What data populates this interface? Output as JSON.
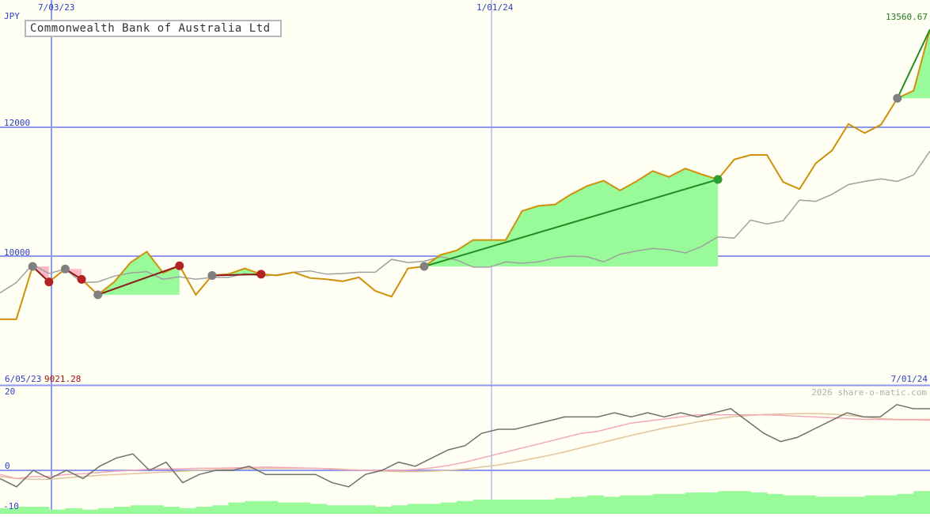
{
  "title": "Commonwealth Bank of Australia Ltd",
  "currency_label": "JPY",
  "watermark": "2026 share-o-matic.com",
  "colors": {
    "background": "#fffff4",
    "grid": "#8e98ee",
    "price": "#d0900a",
    "benchmark": "#a0a0a0",
    "gain_fill": "#98fa98",
    "loss_fill": "#ffb8c8",
    "gain_line": "#228b22",
    "loss_line": "#8b1a1a",
    "gain_dot": "#2e9e2e",
    "loss_dot": "#b22222",
    "pivot_dot": "#808080",
    "momentum": "#707070",
    "ma_fast": "#f4a8b8",
    "ma_slow": "#e2c49c",
    "volume": "#98fa98",
    "label_blue": "#3040c0",
    "label_red": "#a01010",
    "label_green": "#207a20"
  },
  "chart_data": [
    {
      "type": "line",
      "panel": "price",
      "series_unit": "JPY",
      "x_ticks": [
        "7/03/23",
        "1/01/24"
      ],
      "y_ticks": [
        10000,
        12000
      ],
      "ylim": [
        8000,
        13900
      ],
      "range_start_label": "6/05/23",
      "range_end_label": "7/01/24",
      "start_value_label": "9021.28",
      "last_value_label": "13560.67",
      "last_value": 13560.67,
      "series": [
        {
          "role": "price",
          "values": [
            9020,
            9020,
            9840,
            9600,
            9800,
            9640,
            9400,
            9600,
            9900,
            10070,
            9740,
            9850,
            9400,
            9700,
            9720,
            9810,
            9720,
            9700,
            9750,
            9660,
            9640,
            9610,
            9670,
            9460,
            9370,
            9810,
            9840,
            10020,
            10090,
            10250,
            10250,
            10250,
            10700,
            10780,
            10800,
            10960,
            11090,
            11170,
            11020,
            11160,
            11320,
            11230,
            11360,
            11270,
            11190,
            11500,
            11570,
            11570,
            11150,
            11040,
            11440,
            11640,
            12050,
            11910,
            12040,
            12450,
            12570,
            13520
          ]
        },
        {
          "role": "benchmark",
          "values": [
            9430,
            9590,
            9870,
            9730,
            9800,
            9590,
            9600,
            9690,
            9740,
            9760,
            9640,
            9680,
            9640,
            9670,
            9670,
            9730,
            9690,
            9710,
            9750,
            9770,
            9720,
            9730,
            9750,
            9750,
            9950,
            9900,
            9920,
            9990,
            9940,
            9830,
            9830,
            9910,
            9890,
            9910,
            9970,
            10000,
            9990,
            9910,
            10030,
            10080,
            10120,
            10100,
            10050,
            10150,
            10300,
            10280,
            10560,
            10500,
            10550,
            10870,
            10850,
            10960,
            11110,
            11160,
            11200,
            11160,
            11260,
            11630
          ]
        }
      ],
      "trades": [
        {
          "type": "loss",
          "from": 2,
          "to": 3
        },
        {
          "type": "loss",
          "from": 4,
          "to": 5
        },
        {
          "type": "gain",
          "from": 6,
          "to": 11
        },
        {
          "type": "loss",
          "from": 6,
          "to": 11
        },
        {
          "type": "gain",
          "from": 13,
          "to": 16
        },
        {
          "type": "gain",
          "from": 26,
          "to": 44
        },
        {
          "type": "gain",
          "from": 55,
          "to": 57
        }
      ]
    },
    {
      "type": "line",
      "panel": "indicator",
      "y_ticks": [
        20,
        0,
        -10
      ],
      "ylim": [
        -10,
        20
      ],
      "series": [
        {
          "role": "momentum",
          "values": [
            -2,
            -4,
            0,
            -2,
            0,
            -2,
            1,
            3,
            4,
            0,
            2,
            -3,
            -1,
            0,
            0,
            1,
            -1,
            -1,
            -1,
            -1,
            -3,
            -4,
            -1,
            0,
            2,
            1,
            3,
            5,
            6,
            9,
            10,
            10,
            11,
            12,
            13,
            13,
            13,
            14,
            13,
            14,
            13,
            14,
            13,
            14,
            15,
            12,
            9,
            7,
            8,
            10,
            12,
            14,
            13,
            13,
            16,
            15,
            15
          ]
        },
        {
          "role": "ma_fast",
          "values": [
            -1,
            -2,
            -1.5,
            -1.5,
            -1,
            -0.8,
            -0.5,
            -0.2,
            0,
            0.3,
            0.3,
            0.4,
            0.5,
            0.5,
            0.6,
            0.7,
            0.8,
            0.7,
            0.6,
            0.5,
            0.3,
            0.1,
            0,
            0,
            0,
            0.2,
            0.6,
            1.2,
            2,
            3,
            4,
            5,
            6,
            7,
            8,
            9,
            9.5,
            10.5,
            11.5,
            12,
            12.5,
            13,
            13.5,
            13.5,
            13.5,
            13.5,
            13.5,
            13.4,
            13.2,
            13,
            12.8,
            12.6,
            12.4,
            12.4,
            12.3,
            12.3,
            12.2
          ]
        },
        {
          "role": "ma_slow",
          "values": [
            -1.5,
            -2,
            -2.2,
            -2.2,
            -1.8,
            -1.5,
            -1.2,
            -1,
            -0.8,
            -0.6,
            -0.4,
            -0.2,
            0,
            0.2,
            0.3,
            0.4,
            0.5,
            0.5,
            0.5,
            0.5,
            0.4,
            0.2,
            0,
            -0.2,
            -0.3,
            -0.3,
            -0.2,
            0,
            0.3,
            0.8,
            1.3,
            2,
            2.8,
            3.6,
            4.5,
            5.5,
            6.5,
            7.5,
            8.5,
            9.4,
            10.3,
            11,
            11.8,
            12.4,
            13,
            13.3,
            13.6,
            13.7,
            13.8,
            13.8,
            13.7,
            13.4,
            13,
            12.6,
            12.4,
            12.4,
            12.4
          ]
        },
        {
          "role": "volume",
          "values": [
            0.4,
            0.5,
            0.5,
            0.3,
            0.4,
            0.3,
            0.4,
            0.5,
            0.6,
            0.6,
            0.5,
            0.4,
            0.5,
            0.6,
            0.8,
            0.9,
            0.9,
            0.8,
            0.8,
            0.7,
            0.6,
            0.6,
            0.6,
            0.5,
            0.6,
            0.7,
            0.7,
            0.8,
            0.9,
            1.0,
            1.0,
            1.0,
            1.0,
            1.0,
            1.1,
            1.2,
            1.3,
            1.2,
            1.3,
            1.3,
            1.4,
            1.4,
            1.5,
            1.5,
            1.6,
            1.6,
            1.5,
            1.4,
            1.3,
            1.3,
            1.2,
            1.2,
            1.2,
            1.3,
            1.3,
            1.4,
            1.6
          ]
        }
      ]
    }
  ]
}
